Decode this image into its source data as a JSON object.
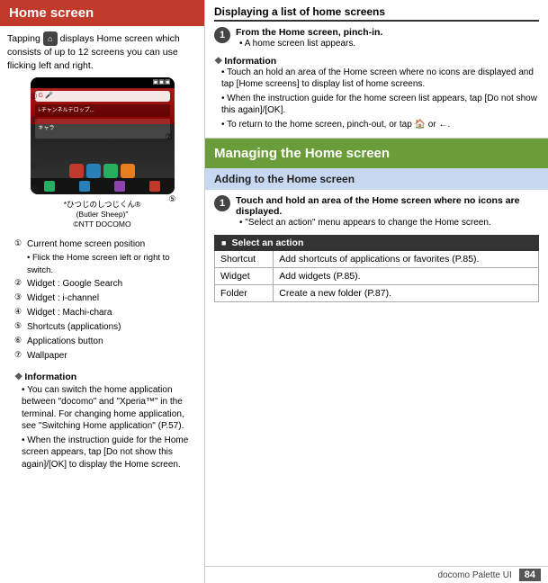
{
  "left": {
    "header": "Home screen",
    "intro": "Tapping",
    "intro2": "displays Home screen which consists of up to 12 screens you can use flicking left and right.",
    "diagram_caption1": "*ひつじのしつじくん®",
    "diagram_caption2": "(Butler Sheep)\"",
    "diagram_caption3": "©NTT DOCOMO",
    "callout7": "⑦",
    "callout5b": "⑤",
    "items": [
      {
        "num": "①",
        "text": "Current home screen position"
      },
      {
        "sub": "• Flick the Home screen left or right to switch."
      },
      {
        "num": "②",
        "text": "Widget : Google Search"
      },
      {
        "num": "③",
        "text": "Widget : i-channel"
      },
      {
        "num": "④",
        "text": "Widget : Machi-chara"
      },
      {
        "num": "⑤",
        "text": "Shortcuts (applications)"
      },
      {
        "num": "⑥",
        "text": "Applications button"
      },
      {
        "num": "⑦",
        "text": "Wallpaper"
      }
    ],
    "info_title": "Information",
    "info_bullets": [
      "You can switch the home application between \"docomo\" and \"Xperia™\" in the terminal. For changing home application, see \"Switching Home application\" (P.57).",
      "When the instruction guide for the Home screen appears, tap [Do not show this again]/[OK] to display the Home screen."
    ]
  },
  "right": {
    "top_section_title": "Displaying a list of home screens",
    "step1_num": "1",
    "step1_title": "From the Home screen, pinch-in.",
    "step1_bullet": "A home screen list appears.",
    "info_title": "Information",
    "info_bullets": [
      "Touch an hold an area of the Home screen where no icons are displayed and tap [Home screens] to display list of home screens.",
      "When the instruction guide for the home screen list appears, tap [Do not show this again]/[OK].",
      "To return to the home screen, pinch-out, or tap 🏠 or ←."
    ],
    "managing_header": "Managing the Home screen",
    "adding_subheader": "Adding to the Home screen",
    "step2_num": "1",
    "step2_title": "Touch and hold an area of the Home screen where no icons are displayed.",
    "step2_bullet": "\"Select an action\" menu appears to change the Home screen.",
    "select_action_label": "Select an action",
    "table_rows": [
      {
        "col1": "Shortcut",
        "col2": "Add shortcuts of applications or favorites (P.85)."
      },
      {
        "col1": "Widget",
        "col2": "Add widgets (P.85)."
      },
      {
        "col1": "Folder",
        "col2": "Create a new folder (P.87)."
      }
    ],
    "footer_text": "docomo Palette UI",
    "page_num": "84"
  }
}
